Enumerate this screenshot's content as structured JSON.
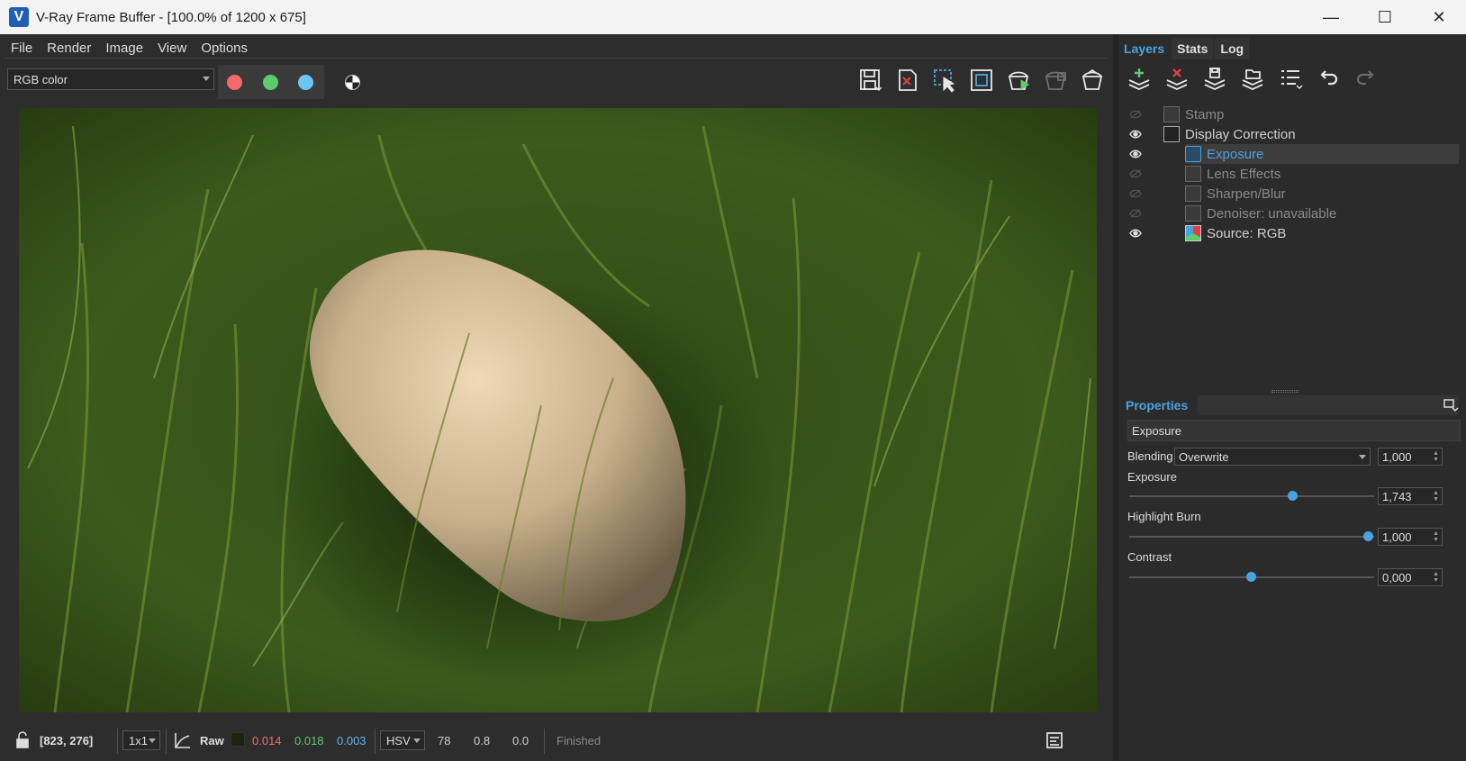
{
  "window": {
    "title": "V-Ray Frame Buffer - [100.0% of 1200 x 675]",
    "minimize": "—",
    "maximize": "☐",
    "close": "✕"
  },
  "menu": [
    "File",
    "Render",
    "Image",
    "View",
    "Options"
  ],
  "toolbar": {
    "channel": "RGB color",
    "channel_colors": {
      "red": "#f26b6b",
      "green": "#5ccc6e",
      "blue": "#6bc7f0"
    },
    "icons": [
      "save-image-icon",
      "clear-image-icon",
      "region-render-icon",
      "track-mouse-icon",
      "render-interactive-icon",
      "stop-render-icon",
      "render-icon"
    ]
  },
  "status": {
    "coords": "[823, 276]",
    "sample": "1x1",
    "mode": "Raw",
    "r": "0.014",
    "g": "0.018",
    "b": "0.003",
    "colorspace": "HSV",
    "h": "78",
    "s": "0.8",
    "v": "0.0",
    "state": "Finished"
  },
  "tabs": [
    {
      "label": "Layers",
      "active": true
    },
    {
      "label": "Stats",
      "active": false
    },
    {
      "label": "Log",
      "active": false
    }
  ],
  "layers": [
    {
      "name": "Stamp",
      "visible": false,
      "indent": 1,
      "selected": false,
      "dim": true
    },
    {
      "name": "Display Correction",
      "visible": true,
      "indent": 1,
      "selected": false,
      "dim": false
    },
    {
      "name": "Exposure",
      "visible": true,
      "indent": 2,
      "selected": true,
      "dim": false
    },
    {
      "name": "Lens Effects",
      "visible": false,
      "indent": 2,
      "selected": false,
      "dim": true
    },
    {
      "name": "Sharpen/Blur",
      "visible": false,
      "indent": 2,
      "selected": false,
      "dim": true
    },
    {
      "name": "Denoiser: unavailable",
      "visible": false,
      "indent": 2,
      "selected": false,
      "dim": true
    },
    {
      "name": "Source: RGB",
      "visible": true,
      "indent": 2,
      "selected": false,
      "dim": false
    }
  ],
  "properties": {
    "title": "Properties",
    "layer_name": "Exposure",
    "blending_label": "Blending",
    "blending_value": "Overwrite",
    "blending_amount": "1,000",
    "sliders": [
      {
        "label": "Exposure",
        "value": "1,743",
        "fraction": 0.665
      },
      {
        "label": "Highlight Burn",
        "value": "1,000",
        "fraction": 0.975
      },
      {
        "label": "Contrast",
        "value": "0,000",
        "fraction": 0.495
      }
    ]
  },
  "accent": "#4aa3df"
}
